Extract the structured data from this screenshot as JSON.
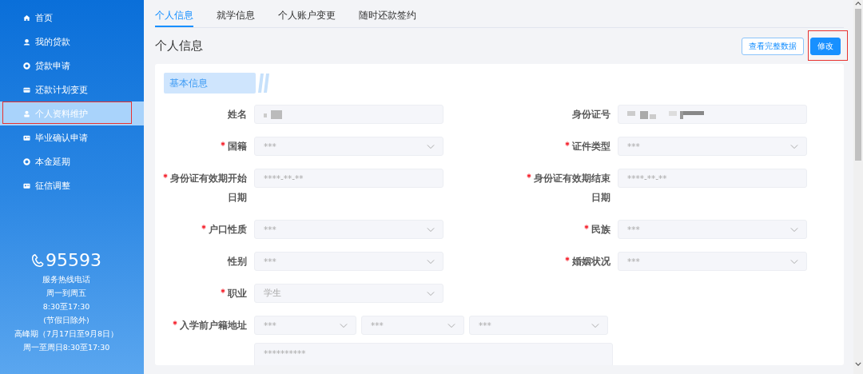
{
  "sidebar": {
    "items": [
      {
        "label": "首页",
        "selected": false,
        "highlighted": false
      },
      {
        "label": "我的贷款",
        "selected": false,
        "highlighted": false
      },
      {
        "label": "贷款申请",
        "selected": false,
        "highlighted": false
      },
      {
        "label": "还款计划变更",
        "selected": false,
        "highlighted": false
      },
      {
        "label": "个人资料维护",
        "selected": true,
        "highlighted": true
      },
      {
        "label": "毕业确认申请",
        "selected": false,
        "highlighted": false
      },
      {
        "label": "本金延期",
        "selected": false,
        "highlighted": false
      },
      {
        "label": "征信调整",
        "selected": false,
        "highlighted": false
      }
    ],
    "hotline": {
      "number": "95593",
      "lines": [
        "服务热线电话",
        "周一到周五",
        "8:30至17:30",
        "(节假日除外)",
        "高峰期（7月17日至9月8日）",
        "周一至周日8:30至17:30"
      ]
    }
  },
  "tabs": [
    {
      "label": "个人信息",
      "selected": true
    },
    {
      "label": "就学信息",
      "selected": false
    },
    {
      "label": "个人账户变更",
      "selected": false
    },
    {
      "label": "随时还款签约",
      "selected": false
    }
  ],
  "page_title": "个人信息",
  "actions": [
    {
      "label": "查看完整数据",
      "kind": "outline",
      "highlighted": false
    },
    {
      "label": "修改",
      "kind": "primary",
      "highlighted": true
    }
  ],
  "section": {
    "title": "基本信息"
  },
  "form": {
    "rows": [
      {
        "fields": [
          {
            "label": "姓名",
            "required": false,
            "kind": "text",
            "masked": true
          },
          {
            "label": "身份证号",
            "required": false,
            "kind": "text",
            "masked": true
          }
        ]
      },
      {
        "fields": [
          {
            "label": "国籍",
            "required": true,
            "kind": "select",
            "value": "***"
          },
          {
            "label": "证件类型",
            "required": true,
            "kind": "select",
            "value": "***"
          }
        ]
      },
      {
        "fields": [
          {
            "label": "身份证有效期开始日期",
            "required": true,
            "kind": "text",
            "value": "****-**-**"
          },
          {
            "label": "身份证有效期结束日期",
            "required": true,
            "kind": "text",
            "value": "****-**-**"
          }
        ]
      },
      {
        "fields": [
          {
            "label": "户口性质",
            "required": true,
            "kind": "select",
            "value": "***"
          },
          {
            "label": "民族",
            "required": true,
            "kind": "select",
            "value": "***"
          }
        ]
      },
      {
        "fields": [
          {
            "label": "性别",
            "required": false,
            "kind": "select",
            "value": "***"
          },
          {
            "label": "婚姻状况",
            "required": true,
            "kind": "select",
            "value": "***"
          }
        ]
      },
      {
        "fields": [
          {
            "label": "职业",
            "required": true,
            "kind": "select",
            "value": "学生"
          }
        ]
      }
    ],
    "address": {
      "label": "入学前户籍地址",
      "required": true,
      "selects": [
        "***",
        "***",
        "***"
      ],
      "detail": "**********"
    }
  }
}
